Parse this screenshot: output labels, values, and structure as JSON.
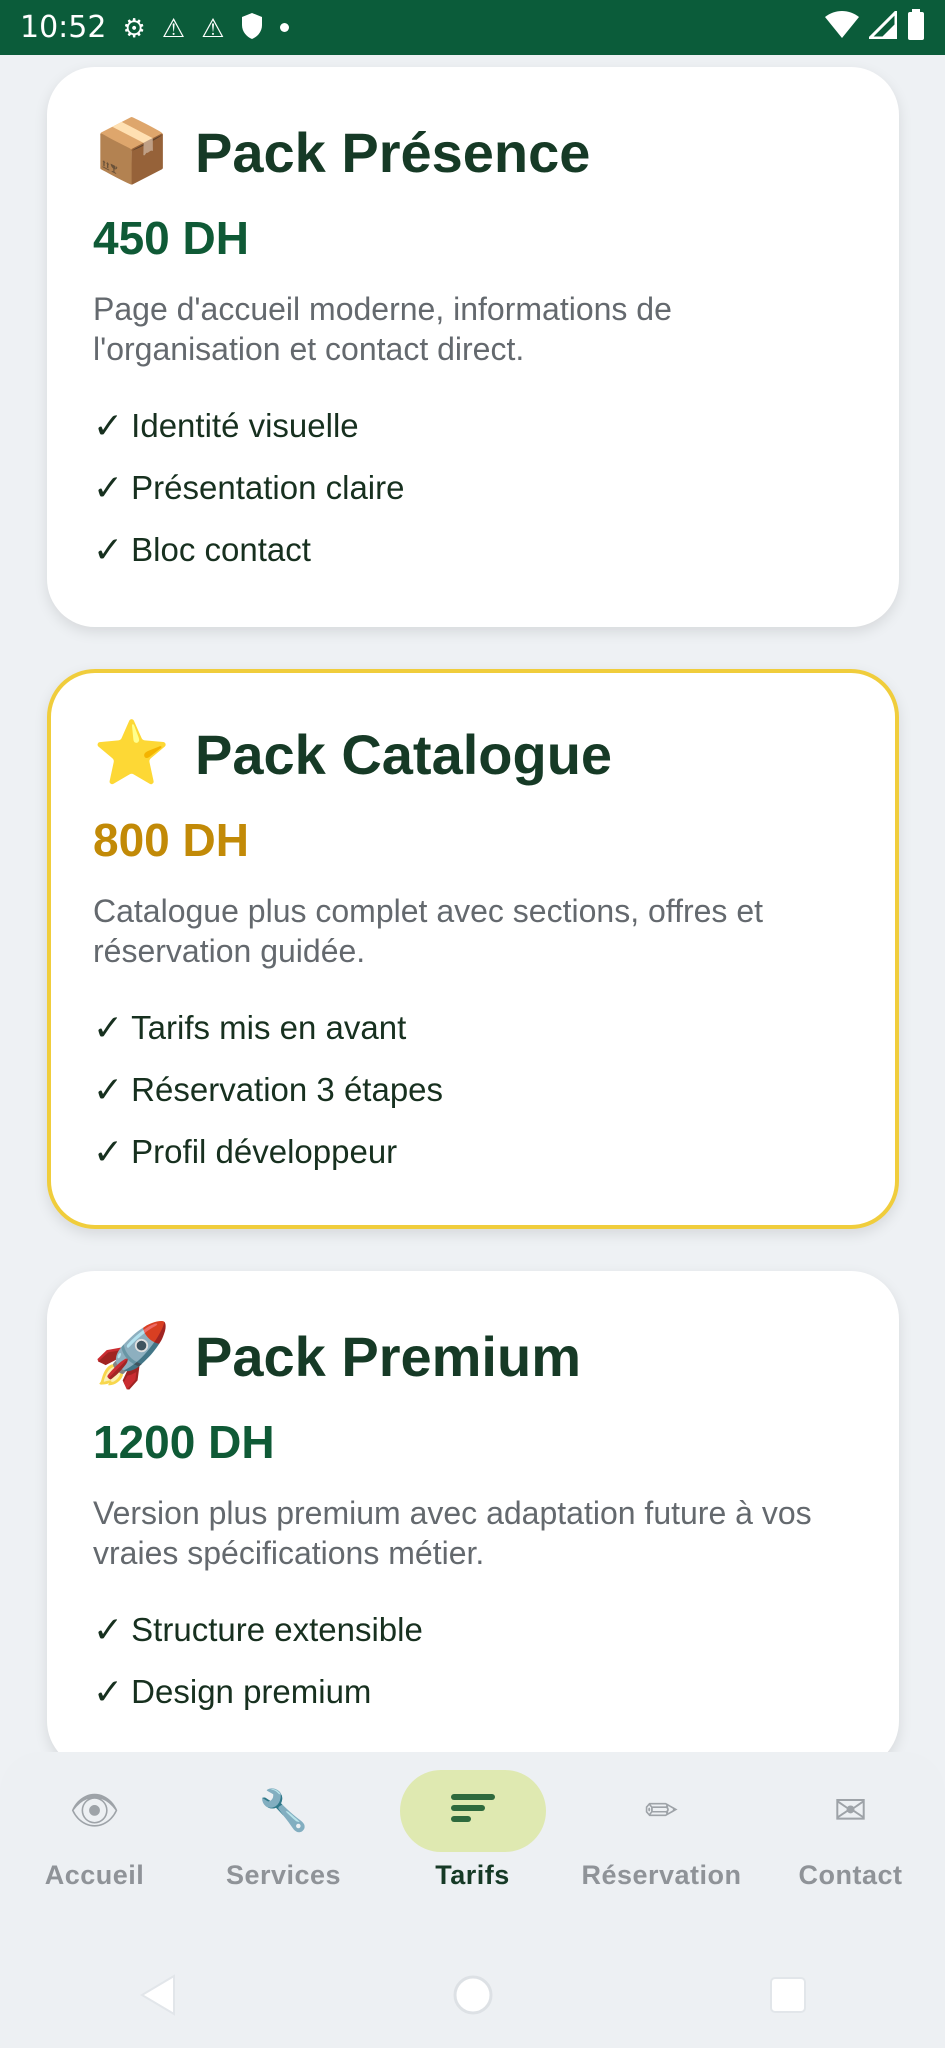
{
  "status_bar": {
    "time": "10:52"
  },
  "packs": [
    {
      "emoji": "📦",
      "title": "Pack Présence",
      "price": "450 DH",
      "description": "Page d'accueil moderne, informations de l'organisation et contact direct.",
      "features": [
        "Identité visuelle",
        "Présentation claire",
        "Bloc contact"
      ]
    },
    {
      "emoji": "⭐",
      "title": "Pack Catalogue",
      "price": "800 DH",
      "description": "Catalogue plus complet avec sections, offres et réservation guidée.",
      "features": [
        "Tarifs mis en avant",
        "Réservation 3 étapes",
        "Profil développeur"
      ]
    },
    {
      "emoji": "🚀",
      "title": "Pack Premium",
      "price": "1200 DH",
      "description": "Version plus premium avec adaptation future à vos vraies spécifications métier.",
      "features": [
        "Structure extensible",
        "Design premium"
      ]
    }
  ],
  "check_mark": "✓",
  "nav": {
    "items": [
      {
        "label": "Accueil",
        "icon": "eye-icon",
        "glyph": "👁"
      },
      {
        "label": "Services",
        "icon": "wrench-icon",
        "glyph": "🔧"
      },
      {
        "label": "Tarifs",
        "icon": "list-icon",
        "glyph": "☰"
      },
      {
        "label": "Réservation",
        "icon": "pencil-icon",
        "glyph": "✏"
      },
      {
        "label": "Contact",
        "icon": "envelope-icon",
        "glyph": "✉"
      }
    ],
    "active": "Tarifs"
  },
  "colors": {
    "status_bar": "#0b5c3a",
    "price_green": "#0f5a36",
    "price_gold": "#c28a07",
    "featured_border": "#f0cd3c",
    "nav_active_pill": "#dfe9b1"
  }
}
